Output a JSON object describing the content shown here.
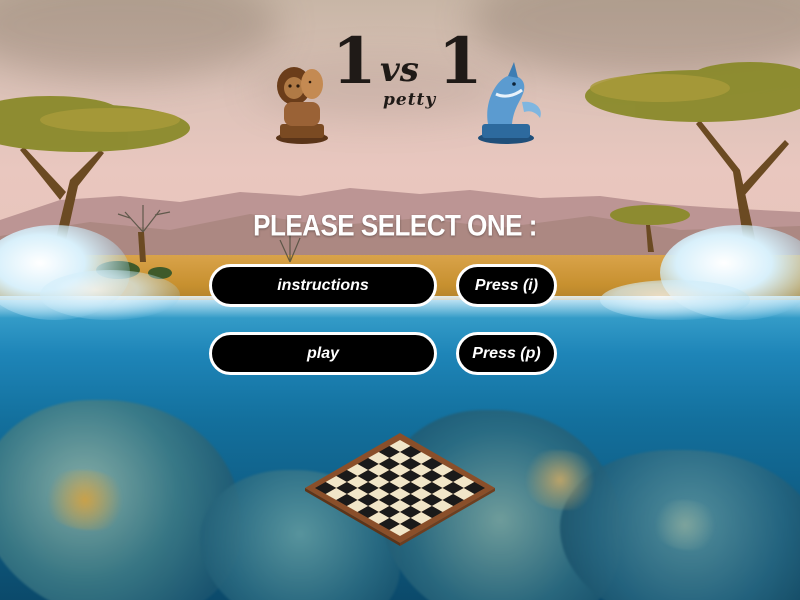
{
  "title": {
    "number_left": "1",
    "vs": "vs",
    "number_right": "1",
    "subtitle": "petty"
  },
  "icons": {
    "left": "lion-chess-piece-icon",
    "right": "shark-chess-piece-icon",
    "board": "chessboard-icon"
  },
  "menu": {
    "heading": "PLEASE SELECT ONE :",
    "options": [
      {
        "label": "instructions",
        "key_label": "Press (i)"
      },
      {
        "label": "play",
        "key_label": "Press (p)"
      }
    ]
  },
  "colors": {
    "button_bg": "#000000",
    "button_border": "#ffffff",
    "button_text": "#ffffff",
    "title_text": "#1f1a17"
  }
}
